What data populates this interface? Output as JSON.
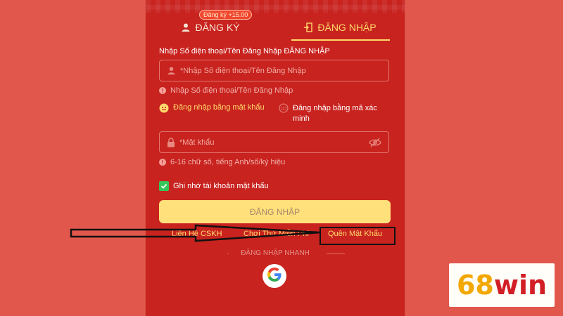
{
  "tabs": {
    "register_label": "ĐĂNG KÝ",
    "register_badge": "Đăng ký +15.00",
    "login_label": "ĐĂNG NHẬP"
  },
  "form": {
    "section_label": "Nhập Số điện thoại/Tên Đăng Nhập ĐĂNG NHẬP",
    "username_placeholder": "*Nhập Số điện thoại/Tên Đăng Nhập",
    "username_error": "Nhập Số điện thoại/Tên Đăng Nhập",
    "option_password": "Đăng nhập bằng mật khẩu",
    "option_code": "Đăng nhập bằng mã xác minh",
    "password_placeholder": "*Mật khẩu",
    "password_error": "6-16 chữ số, tiếng Anh/số/ký hiệu",
    "remember_label": "Ghi nhớ tài khoản mật khẩu",
    "remember_checked": true,
    "login_button": "ĐĂNG NHẬP"
  },
  "links": {
    "cskh": "Liên Hệ CSKH",
    "trial": "Chơi Thử Miễn Phí",
    "forgot": "Quên Mật Khẩu"
  },
  "quick_login": {
    "label": "ĐĂNG NHẬP NHANH",
    "provider_icon": "google-icon"
  },
  "brand": {
    "number": "68",
    "text": "win"
  },
  "colors": {
    "background": "#e2574c",
    "panel": "#c8231f",
    "accent": "#ffd96b",
    "button": "#ffe07a",
    "brand_gold": "#f2a800",
    "brand_red": "#d11f25"
  }
}
